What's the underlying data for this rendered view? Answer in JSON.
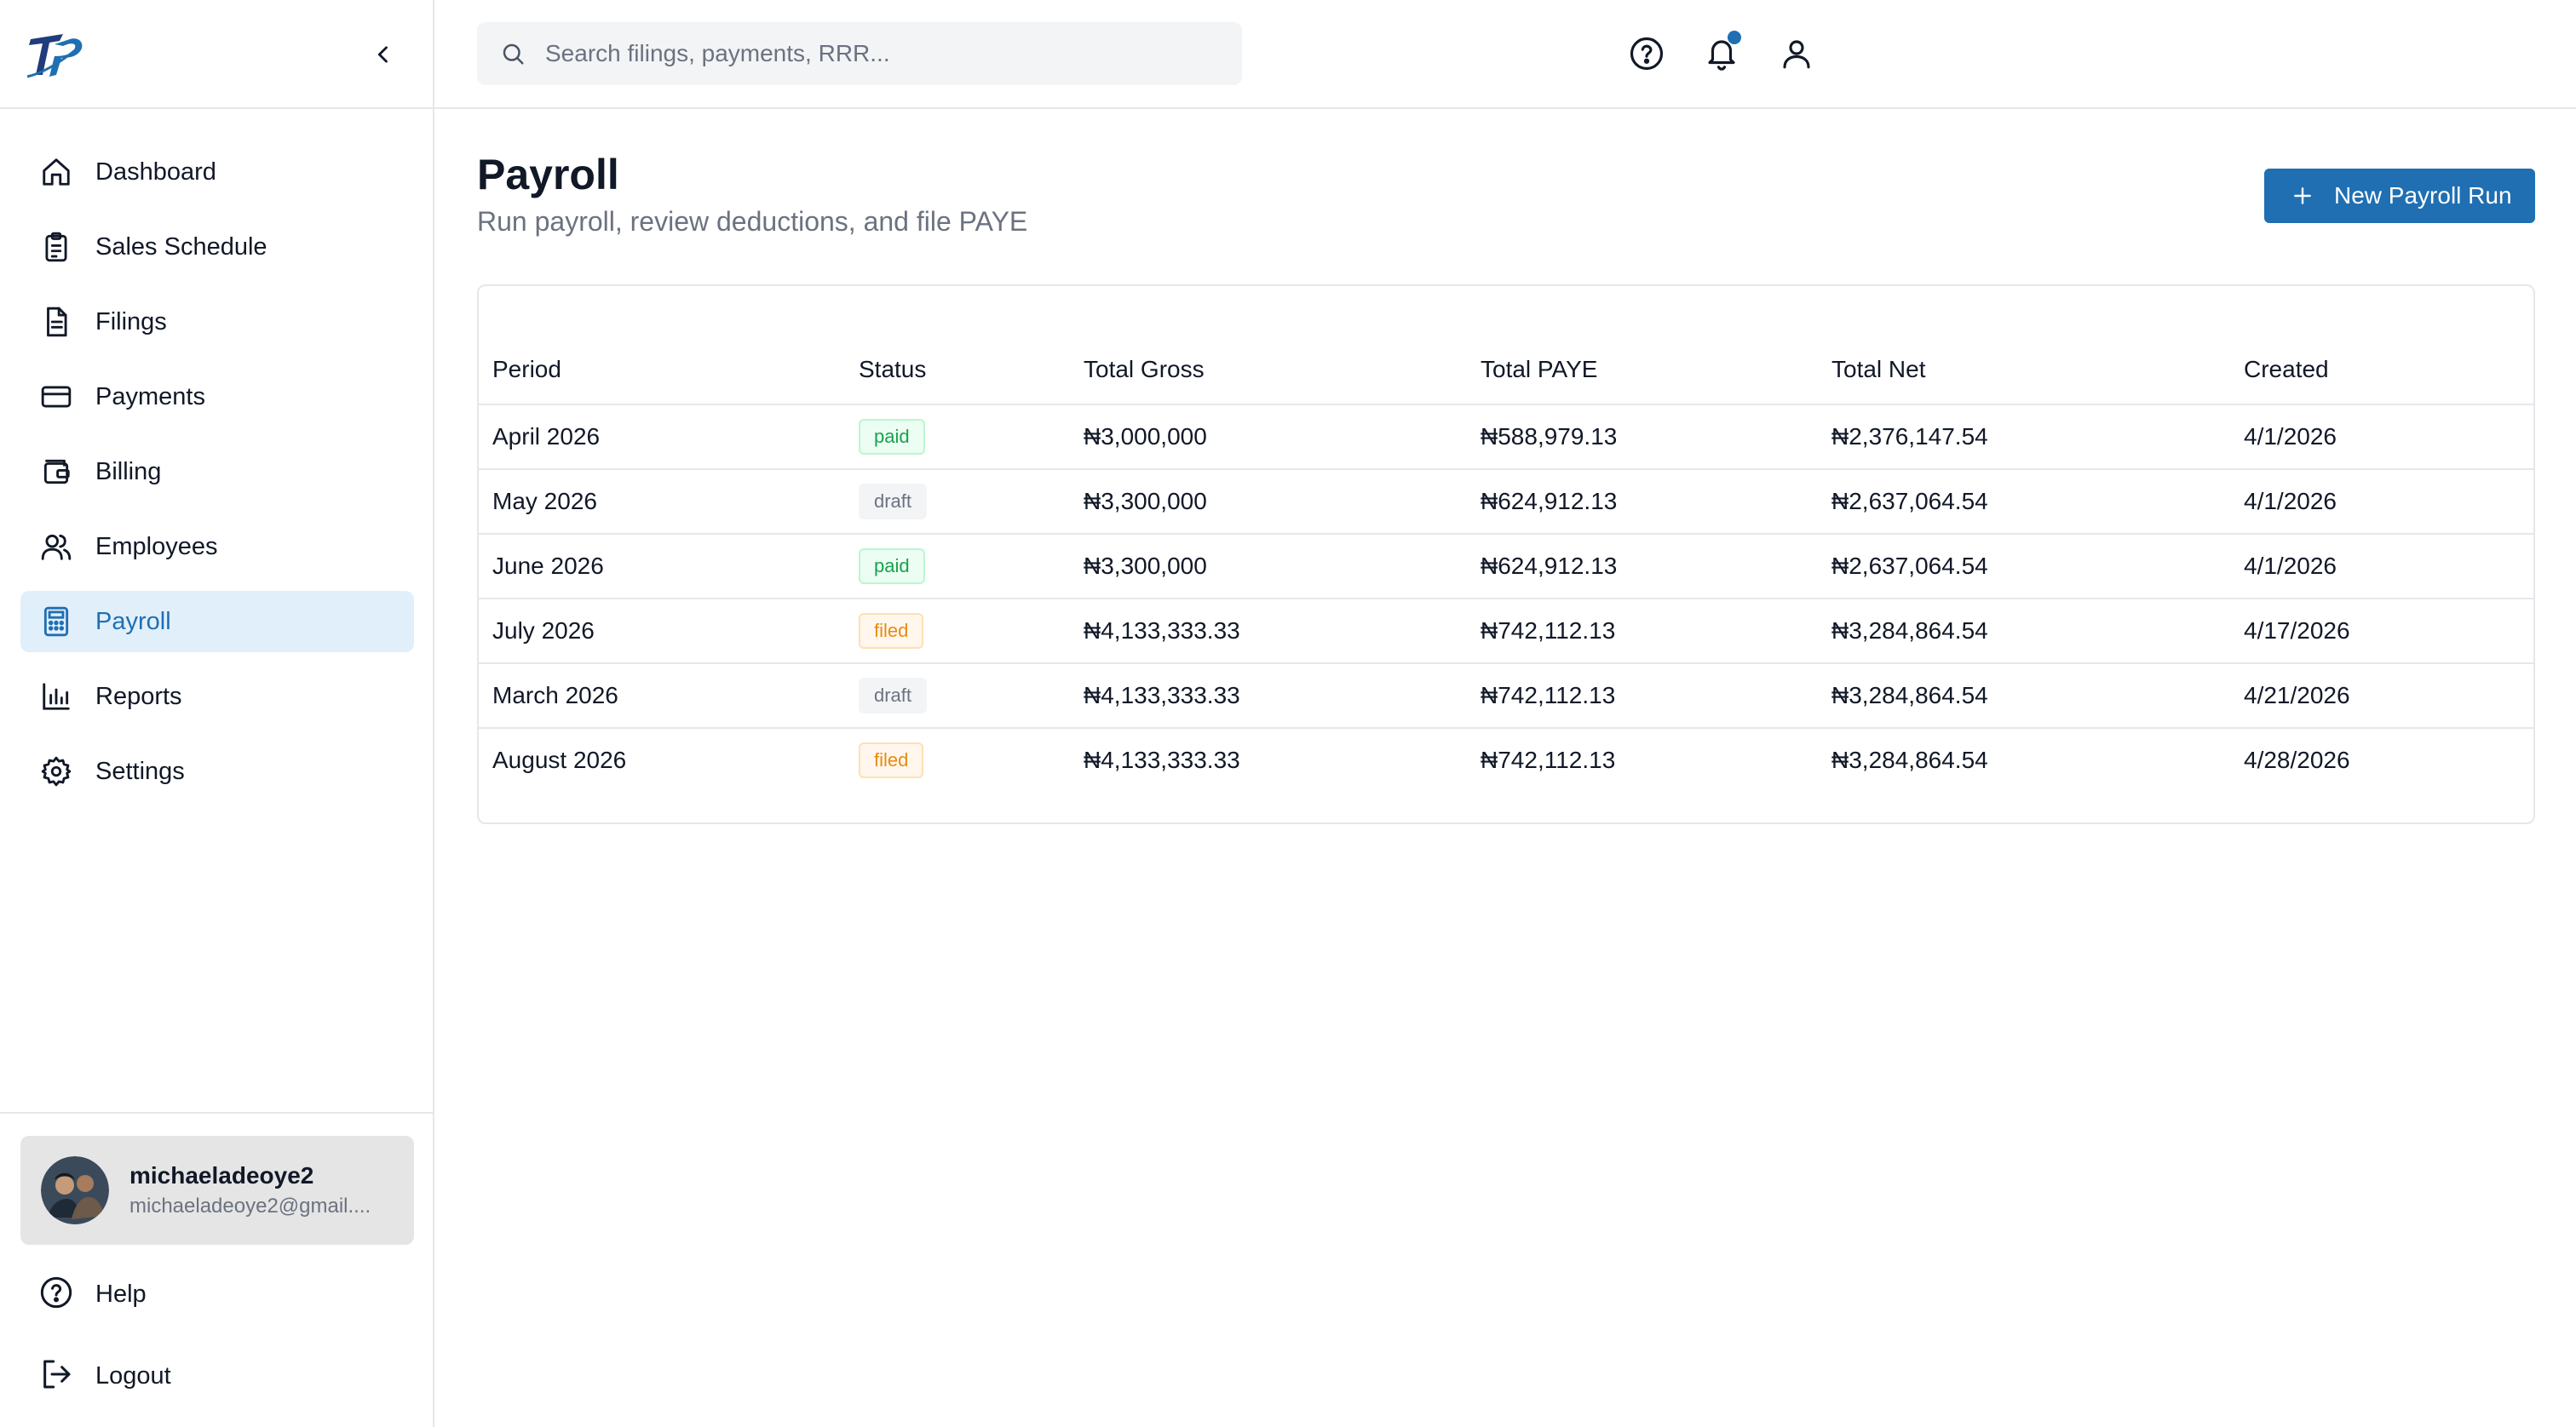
{
  "sidebar": {
    "collapse_icon": "chevron-left-icon",
    "items": [
      {
        "label": "Dashboard",
        "icon": "home-icon"
      },
      {
        "label": "Sales Schedule",
        "icon": "clipboard-icon"
      },
      {
        "label": "Filings",
        "icon": "file-text-icon"
      },
      {
        "label": "Payments",
        "icon": "credit-card-icon"
      },
      {
        "label": "Billing",
        "icon": "wallet-icon"
      },
      {
        "label": "Employees",
        "icon": "users-icon"
      },
      {
        "label": "Payroll",
        "icon": "calculator-icon",
        "active": true
      },
      {
        "label": "Reports",
        "icon": "bar-chart-icon"
      },
      {
        "label": "Settings",
        "icon": "gear-icon"
      }
    ],
    "user": {
      "name": "michaeladeoye2",
      "email": "michaeladeoye2@gmail...."
    },
    "help_label": "Help",
    "logout_label": "Logout"
  },
  "topbar": {
    "search_placeholder": "Search filings, payments, RRR..."
  },
  "page": {
    "title": "Payroll",
    "subtitle": "Run payroll, review deductions, and file PAYE",
    "new_button_label": "New Payroll Run"
  },
  "table": {
    "columns": [
      "Period",
      "Status",
      "Total Gross",
      "Total PAYE",
      "Total Net",
      "Created"
    ],
    "rows": [
      {
        "period": "April 2026",
        "status": "paid",
        "gross": "₦3,000,000",
        "paye": "₦588,979.13",
        "net": "₦2,376,147.54",
        "created": "4/1/2026"
      },
      {
        "period": "May 2026",
        "status": "draft",
        "gross": "₦3,300,000",
        "paye": "₦624,912.13",
        "net": "₦2,637,064.54",
        "created": "4/1/2026"
      },
      {
        "period": "June 2026",
        "status": "paid",
        "gross": "₦3,300,000",
        "paye": "₦624,912.13",
        "net": "₦2,637,064.54",
        "created": "4/1/2026"
      },
      {
        "period": "July 2026",
        "status": "filed",
        "gross": "₦4,133,333.33",
        "paye": "₦742,112.13",
        "net": "₦3,284,864.54",
        "created": "4/17/2026"
      },
      {
        "period": "March 2026",
        "status": "draft",
        "gross": "₦4,133,333.33",
        "paye": "₦742,112.13",
        "net": "₦3,284,864.54",
        "created": "4/21/2026"
      },
      {
        "period": "August 2026",
        "status": "filed",
        "gross": "₦4,133,333.33",
        "paye": "₦742,112.13",
        "net": "₦3,284,864.54",
        "created": "4/28/2026"
      }
    ]
  },
  "colors": {
    "accent": "#1f6fb2",
    "active_bg": "#e1effb",
    "notification_dot": "#1f6fb2"
  }
}
